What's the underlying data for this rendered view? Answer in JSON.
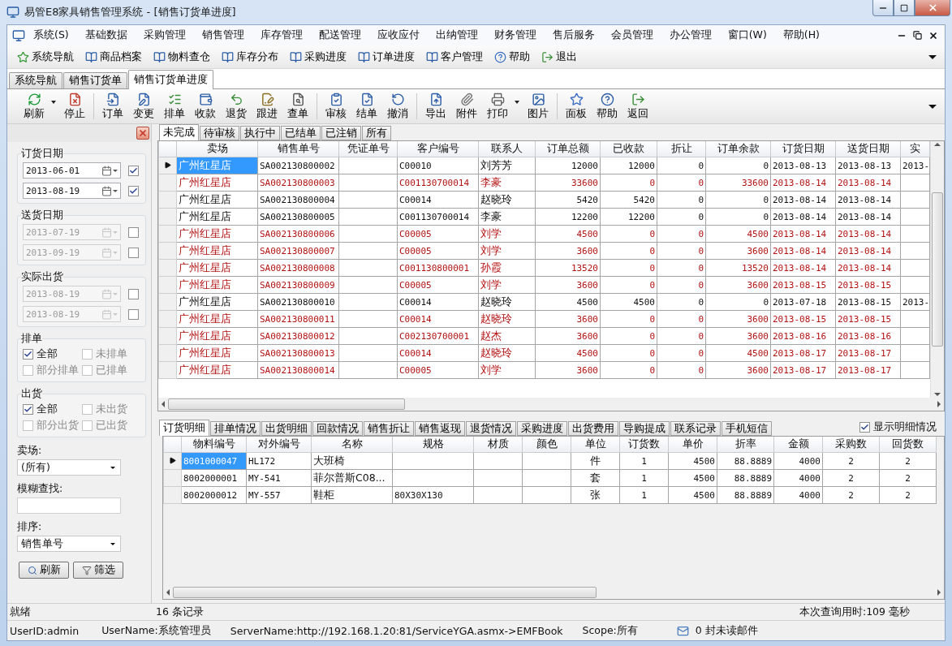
{
  "window": {
    "title": "易管E8家具销售管理系统 - [销售订货单进度]"
  },
  "menu": [
    "系统(S)",
    "基础数据",
    "采购管理",
    "销售管理",
    "库存管理",
    "配送管理",
    "应收应付",
    "出纳管理",
    "财务管理",
    "售后服务",
    "会员管理",
    "办公管理",
    "窗口(W)",
    "帮助(H)"
  ],
  "quick_bar": [
    {
      "label": "系统导航",
      "kind": "star"
    },
    {
      "label": "商品档案",
      "kind": "book"
    },
    {
      "label": "物料查仓",
      "kind": "book"
    },
    {
      "label": "库存分布",
      "kind": "book"
    },
    {
      "label": "采购进度",
      "kind": "book"
    },
    {
      "label": "订单进度",
      "kind": "book"
    },
    {
      "label": "客户管理",
      "kind": "book"
    },
    {
      "label": "帮助",
      "kind": "help"
    },
    {
      "label": "退出",
      "kind": "exit"
    }
  ],
  "doc_tabs": [
    {
      "label": "系统导航",
      "selected": false
    },
    {
      "label": "销售订货单",
      "selected": false
    },
    {
      "label": "销售订货单进度",
      "selected": true
    }
  ],
  "toolbar": [
    [
      {
        "label": "刷新",
        "dropdown": true
      },
      {
        "label": "停止"
      }
    ],
    [
      {
        "label": "订单"
      },
      {
        "label": "变更"
      },
      {
        "label": "排单"
      },
      {
        "label": "收款"
      },
      {
        "label": "退货"
      },
      {
        "label": "跟进"
      },
      {
        "label": "查单"
      }
    ],
    [
      {
        "label": "审核"
      },
      {
        "label": "结单"
      },
      {
        "label": "撤消"
      }
    ],
    [
      {
        "label": "导出"
      },
      {
        "label": "附件"
      },
      {
        "label": "打印",
        "dropdown": true
      },
      {
        "label": "图片"
      }
    ],
    [
      {
        "label": "面板"
      },
      {
        "label": "帮助"
      },
      {
        "label": "返回"
      }
    ]
  ],
  "date_groups": [
    {
      "label": "订货日期",
      "dates": [
        {
          "value": "2013-06-01",
          "checked": true
        },
        {
          "value": "2013-08-19",
          "checked": true
        }
      ]
    },
    {
      "label": "送货日期",
      "dates": [
        {
          "value": "2013-07-19",
          "checked": false
        },
        {
          "value": "2013-09-19",
          "checked": false
        }
      ]
    },
    {
      "label": "实际出货",
      "dates": [
        {
          "value": "2013-08-19",
          "checked": false
        },
        {
          "value": "2013-08-19",
          "checked": false
        }
      ]
    }
  ],
  "check_groups": [
    {
      "label": "排单",
      "options": [
        {
          "label": "全部",
          "checked": true
        },
        {
          "label": "未排单",
          "checked": false
        },
        {
          "label": "部分排单",
          "checked": false
        },
        {
          "label": "已排单",
          "checked": false
        }
      ]
    },
    {
      "label": "出货",
      "options": [
        {
          "label": "全部",
          "checked": true
        },
        {
          "label": "未出货",
          "checked": false
        },
        {
          "label": "部分出货",
          "checked": false
        },
        {
          "label": "已出货",
          "checked": false
        }
      ]
    }
  ],
  "market": {
    "label": "卖场:",
    "value": "(所有)"
  },
  "search": {
    "label": "模糊查找:"
  },
  "sort": {
    "label": "排序:",
    "value": "销售单号"
  },
  "filter_buttons": [
    "刷新",
    "筛选"
  ],
  "status_tabs": [
    {
      "label": "未完成",
      "selected": true
    },
    {
      "label": "待审核",
      "selected": false
    },
    {
      "label": "执行中",
      "selected": false
    },
    {
      "label": "已结单",
      "selected": false
    },
    {
      "label": "已注销",
      "selected": false
    },
    {
      "label": "所有",
      "selected": false
    }
  ],
  "orders": {
    "columns": [
      "卖场",
      "销售单号",
      "凭证单号",
      "客户编号",
      "联系人",
      "订单总额",
      "已收款",
      "折让",
      "订单余款",
      "订货日期",
      "送货日期",
      "实"
    ],
    "rows": [
      {
        "selected": true,
        "unpaid": false,
        "market": "广州红星店",
        "order_no": "SA002130800002",
        "customer_no": "C00010",
        "contact": "刘芳芳",
        "total": "12000",
        "received": "12000",
        "discount": "0",
        "balance": "0",
        "order_date": "2013-08-13",
        "delivery_date": "2013-08-13",
        "column_12": "2013-"
      },
      {
        "selected": false,
        "unpaid": true,
        "market": "广州红星店",
        "order_no": "SA002130800003",
        "customer_no": "C001130700014",
        "contact": "李豪",
        "total": "33600",
        "received": "0",
        "discount": "0",
        "balance": "33600",
        "order_date": "2013-08-14",
        "delivery_date": "2013-08-14"
      },
      {
        "selected": false,
        "unpaid": false,
        "market": "广州红星店",
        "order_no": "SA002130800004",
        "customer_no": "C00014",
        "contact": "赵晓玲",
        "total": "5420",
        "received": "5420",
        "discount": "0",
        "balance": "0",
        "order_date": "2013-08-14",
        "delivery_date": "2013-08-14"
      },
      {
        "selected": false,
        "unpaid": false,
        "market": "广州红星店",
        "order_no": "SA002130800005",
        "customer_no": "C001130700014",
        "contact": "李豪",
        "total": "12200",
        "received": "12200",
        "discount": "0",
        "balance": "0",
        "order_date": "2013-08-14",
        "delivery_date": "2013-08-14"
      },
      {
        "selected": false,
        "unpaid": true,
        "market": "广州红星店",
        "order_no": "SA002130800006",
        "customer_no": "C00005",
        "contact": "刘学",
        "total": "4500",
        "received": "0",
        "discount": "0",
        "balance": "4500",
        "order_date": "2013-08-14",
        "delivery_date": "2013-08-14"
      },
      {
        "selected": false,
        "unpaid": true,
        "market": "广州红星店",
        "order_no": "SA002130800007",
        "customer_no": "C00005",
        "contact": "刘学",
        "total": "3600",
        "received": "0",
        "discount": "0",
        "balance": "3600",
        "order_date": "2013-08-14",
        "delivery_date": "2013-08-14"
      },
      {
        "selected": false,
        "unpaid": true,
        "market": "广州红星店",
        "order_no": "SA002130800008",
        "customer_no": "C001130800001",
        "contact": "孙霞",
        "total": "13520",
        "received": "0",
        "discount": "0",
        "balance": "13520",
        "order_date": "2013-08-14",
        "delivery_date": "2013-08-14"
      },
      {
        "selected": false,
        "unpaid": true,
        "market": "广州红星店",
        "order_no": "SA002130800009",
        "customer_no": "C00005",
        "contact": "刘学",
        "total": "3600",
        "received": "0",
        "discount": "0",
        "balance": "3600",
        "order_date": "2013-08-15",
        "delivery_date": "2013-08-15"
      },
      {
        "selected": false,
        "unpaid": false,
        "market": "广州红星店",
        "order_no": "SA002130800010",
        "customer_no": "C00014",
        "contact": "赵晓玲",
        "total": "4500",
        "received": "4500",
        "discount": "0",
        "balance": "0",
        "order_date": "2013-07-18",
        "delivery_date": "2013-08-15",
        "column_12": "2013-"
      },
      {
        "selected": false,
        "unpaid": true,
        "market": "广州红星店",
        "order_no": "SA002130800011",
        "customer_no": "C00014",
        "contact": "赵晓玲",
        "total": "3600",
        "received": "0",
        "discount": "0",
        "balance": "3600",
        "order_date": "2013-08-15",
        "delivery_date": "2013-08-15"
      },
      {
        "selected": false,
        "unpaid": true,
        "market": "广州红星店",
        "order_no": "SA002130800012",
        "customer_no": "C002130700001",
        "contact": "赵杰",
        "total": "3600",
        "received": "0",
        "discount": "0",
        "balance": "3600",
        "order_date": "2013-08-16",
        "delivery_date": "2013-08-16"
      },
      {
        "selected": false,
        "unpaid": true,
        "market": "广州红星店",
        "order_no": "SA002130800013",
        "customer_no": "C00014",
        "contact": "赵晓玲",
        "total": "4500",
        "received": "0",
        "discount": "0",
        "balance": "4500",
        "order_date": "2013-08-17",
        "delivery_date": "2013-08-17"
      },
      {
        "selected": false,
        "unpaid": true,
        "market": "广州红星店",
        "order_no": "SA002130800014",
        "customer_no": "C00005",
        "contact": "刘学",
        "total": "3600",
        "received": "0",
        "discount": "0",
        "balance": "3600",
        "order_date": "2013-08-17",
        "delivery_date": "2013-08-17"
      }
    ]
  },
  "detail_tabs": [
    {
      "label": "订货明细",
      "selected": true
    },
    {
      "label": "排单情况",
      "selected": false
    },
    {
      "label": "出货明细",
      "selected": false
    },
    {
      "label": "回款情况",
      "selected": false
    },
    {
      "label": "销售折让",
      "selected": false
    },
    {
      "label": "销售返现",
      "selected": false
    },
    {
      "label": "退货情况",
      "selected": false
    },
    {
      "label": "采购进度",
      "selected": false
    },
    {
      "label": "出货费用",
      "selected": false
    },
    {
      "label": "导购提成",
      "selected": false
    },
    {
      "label": "联系记录",
      "selected": false
    },
    {
      "label": "手机短信",
      "selected": false
    }
  ],
  "show_detail": {
    "label": "显示明细情况",
    "checked": true
  },
  "details": {
    "columns": [
      "物料编号",
      "对外编号",
      "名称",
      "规格",
      "材质",
      "颜色",
      "单位",
      "订货数",
      "单价",
      "折率",
      "金额",
      "采购数",
      "回货数"
    ],
    "rows": [
      {
        "selected": true,
        "material_no": "8001000047",
        "external_no": "HL172",
        "name": "大班椅",
        "unit": "件",
        "qty": "1",
        "price": "4500",
        "rate": "88.8889",
        "amount": "4000",
        "purchased": "2",
        "returned": "2"
      },
      {
        "selected": false,
        "material_no": "8002000001",
        "external_no": "MY-541",
        "name": "菲尔普斯C08...",
        "unit": "套",
        "qty": "1",
        "price": "4500",
        "rate": "88.8889",
        "amount": "4000",
        "purchased": "2",
        "returned": "2"
      },
      {
        "selected": false,
        "material_no": "8002000012",
        "external_no": "MY-557",
        "name": "鞋柜",
        "spec": "80X30X130",
        "unit": "张",
        "qty": "1",
        "price": "4500",
        "rate": "88.8889",
        "amount": "4000",
        "purchased": "2",
        "returned": "2"
      }
    ]
  },
  "status_bar": {
    "ready": "就绪",
    "records": "16 条记录",
    "query_time": "本次查询用时:109 毫秒"
  },
  "user_bar": {
    "user_id": "UserID:admin",
    "user_name": "UserName:系统管理员",
    "server": "ServerName:http://192.168.1.20:81/ServiceYGA.asmx->EMFBook",
    "scope": "Scope:所有",
    "mail": "0 封未读邮件"
  }
}
